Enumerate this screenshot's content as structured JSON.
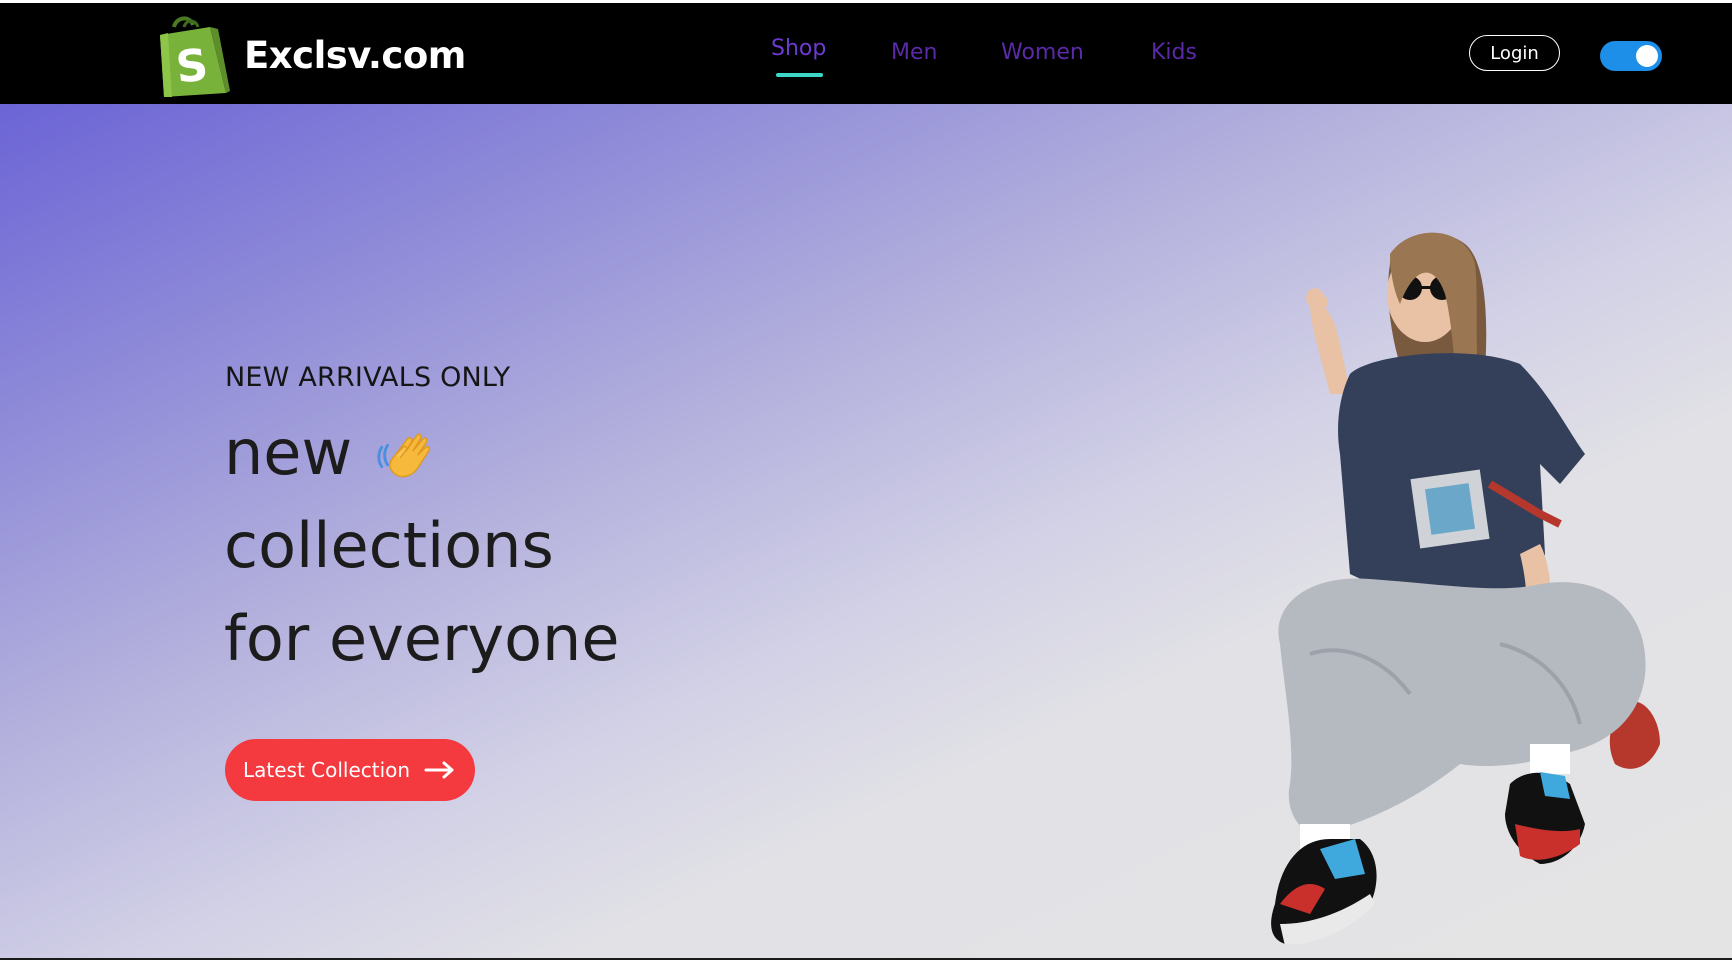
{
  "brand": {
    "name": "Exclsv.com",
    "icon": "shopping-bag-icon"
  },
  "nav": {
    "items": [
      {
        "label": "Shop",
        "active": true
      },
      {
        "label": "Men",
        "active": false
      },
      {
        "label": "Women",
        "active": false
      },
      {
        "label": "Kids",
        "active": false
      }
    ],
    "login_label": "Login",
    "theme_toggle": {
      "on": true
    }
  },
  "hero": {
    "eyebrow": "NEW ARRIVALS ONLY",
    "lines": [
      "new",
      "collections",
      "for everyone"
    ],
    "wave_icon": "waving-hand-icon",
    "cta_label": "Latest Collection",
    "cta_icon": "arrow-right-icon"
  },
  "colors": {
    "nav_bg": "#000000",
    "nav_link": "#5b2aa8",
    "nav_active_underline": "#3ed6c7",
    "toggle": "#1d8fe8",
    "cta": "#f4393f",
    "brand_green": "#79b23a"
  }
}
